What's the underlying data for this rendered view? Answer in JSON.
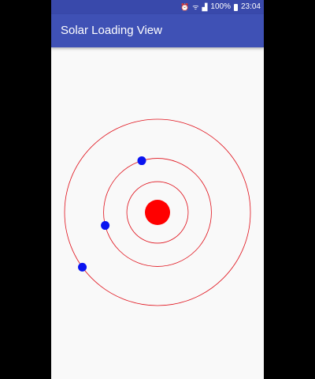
{
  "status_bar": {
    "alarm_icon": "alarm-icon",
    "wifi_icon": "wifi-icon",
    "signal_icon": "signal-icon",
    "battery_icon": "battery-icon",
    "battery_percent": "100%",
    "time": "23:04"
  },
  "app_bar": {
    "title": "Solar Loading View"
  },
  "solar": {
    "sun_color": "#ff0000",
    "orbit_color": "#e0101a",
    "planet_color": "#0a14f0",
    "orbit_ratios": [
      0.33,
      0.58,
      1.0
    ],
    "planet_angles_deg": [
      107,
      194,
      216
    ]
  }
}
